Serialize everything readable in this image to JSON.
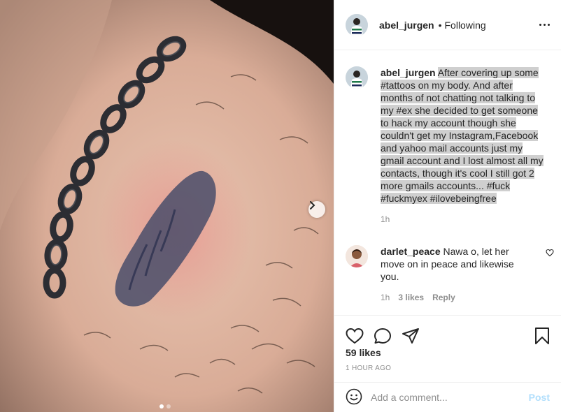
{
  "post": {
    "author": "abel_jurgen",
    "separator": "•",
    "follow_status": "Following",
    "caption_prefix": "abel_jurgen",
    "caption_lines": [
      "After covering up some",
      "#tattoos on my body. And after",
      "months of not chatting not talking to",
      "my #ex she decided to get someone",
      "to hack my account though she",
      "couldn't get my Instagram,Facebook",
      "and yahoo mail accounts just my",
      "gmail account and I lost almost all my",
      "contacts, though it's cool I still got 2",
      "more gmails accounts... #fuck",
      "#fuckmyex #ilovebeingfree"
    ],
    "caption_age": "1h",
    "likes": "59 likes",
    "posted_ago": "1 HOUR AGO"
  },
  "comment": {
    "author": "darlet_peace",
    "text": "Nawa o, let her move on in peace and likewise you.",
    "age": "1h",
    "likes": "3 likes",
    "reply_label": "Reply"
  },
  "add_comment": {
    "placeholder": "Add a comment...",
    "post_label": "Post"
  },
  "icons": {
    "like": "heart-icon",
    "comment": "comment-icon",
    "share": "paper-plane-icon",
    "save": "bookmark-icon",
    "emoji": "smiley-icon",
    "next": "chevron-right-icon",
    "more": "more-dots-icon"
  },
  "carousel": {
    "slide_count": 2,
    "current_slide": 1
  },
  "colors": {
    "post_button": "#b2dffc",
    "secondary_text": "#8e8e8e",
    "highlight": "#cfcfcf"
  }
}
